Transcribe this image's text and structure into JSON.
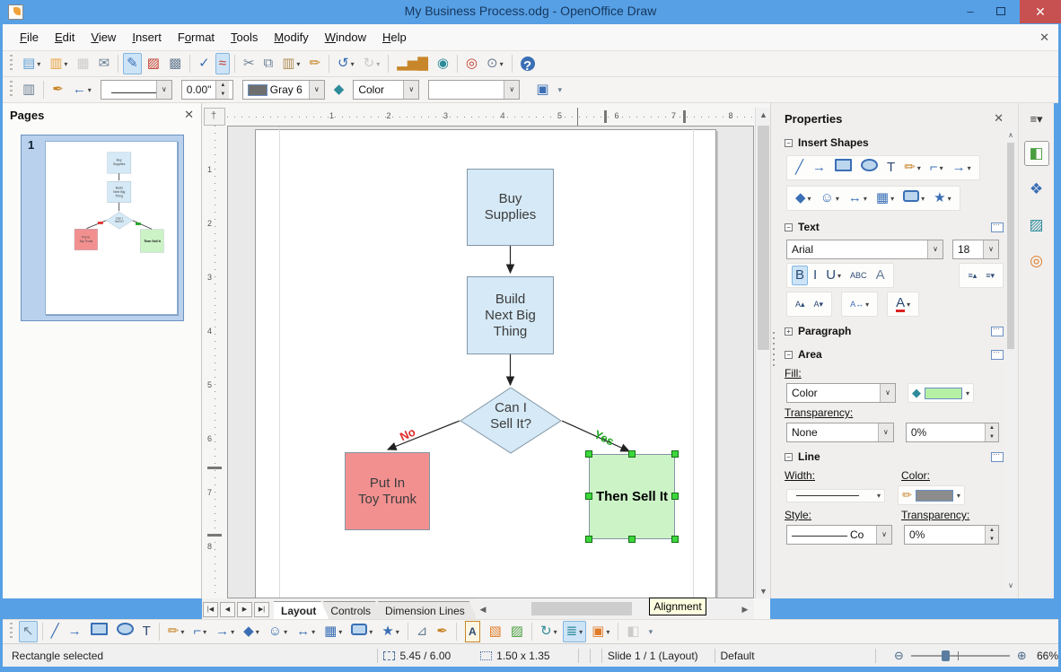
{
  "window": {
    "title": "My Business Process.odg - OpenOffice Draw",
    "minimize": "–",
    "close": "✕"
  },
  "menubar": {
    "items": [
      {
        "label": "File",
        "u": 0
      },
      {
        "label": "Edit",
        "u": 0
      },
      {
        "label": "View",
        "u": 0
      },
      {
        "label": "Insert",
        "u": 0
      },
      {
        "label": "Format",
        "u": 1
      },
      {
        "label": "Tools",
        "u": 0
      },
      {
        "label": "Modify",
        "u": 0
      },
      {
        "label": "Window",
        "u": 0
      },
      {
        "label": "Help",
        "u": 0
      }
    ],
    "close": "✕"
  },
  "toolbars": {
    "standard": [
      {
        "n": "new-document-icon",
        "g": "▤",
        "c": "ic-sky",
        "d": 1
      },
      {
        "n": "open-icon",
        "g": "▥",
        "c": "ic-amber",
        "d": 1
      },
      {
        "n": "save-icon",
        "g": "▦",
        "c": "ic-dis",
        "st": "dis"
      },
      {
        "n": "email-icon",
        "g": "✉",
        "c": "ic-slate"
      },
      {
        "t": "s"
      },
      {
        "n": "edit-file-icon",
        "g": "✎",
        "c": "ic-blue",
        "st": "on"
      },
      {
        "n": "export-pdf-icon",
        "g": "▨",
        "c": "ic-red"
      },
      {
        "n": "print-icon",
        "g": "▩",
        "c": "ic-slate"
      },
      {
        "t": "s"
      },
      {
        "n": "spelling-icon",
        "g": "✓",
        "c": "ic-blue"
      },
      {
        "n": "autospellcheck-icon",
        "g": "≈",
        "c": "ic-red",
        "st": "on"
      },
      {
        "t": "s"
      },
      {
        "n": "cut-icon",
        "g": "✂",
        "c": "ic-slate"
      },
      {
        "n": "copy-icon",
        "g": "⧉",
        "c": "ic-slate"
      },
      {
        "n": "paste-icon",
        "g": "▥",
        "c": "ic-tan",
        "d": 1
      },
      {
        "n": "clone-formatting-icon",
        "g": "✏",
        "c": "ic-gold"
      },
      {
        "t": "s"
      },
      {
        "n": "undo-icon",
        "g": "↺",
        "c": "ic-blue",
        "d": 1
      },
      {
        "n": "redo-icon",
        "g": "↻",
        "c": "ic-dis",
        "st": "dis",
        "d": 1
      },
      {
        "t": "s"
      },
      {
        "n": "chart-icon",
        "g": "▂▅▇",
        "c": "ic-gold"
      },
      {
        "n": "hyperlink-icon",
        "g": "◉",
        "c": "ic-teal"
      },
      {
        "t": "s"
      },
      {
        "n": "navigator-icon",
        "g": "◎",
        "c": "ic-red"
      },
      {
        "n": "zoom-icon",
        "g": "⊙",
        "c": "ic-slate",
        "d": 1
      },
      {
        "t": "s"
      },
      {
        "n": "help-icon",
        "g": "?",
        "c": "ic-help"
      }
    ],
    "linefill": {
      "pre": [
        {
          "n": "styles-window-icon",
          "g": "▥",
          "c": "ic-slate"
        },
        {
          "t": "s"
        },
        {
          "n": "line-dialog-icon",
          "g": "✒",
          "c": "ic-gold"
        },
        {
          "n": "arrowheads-icon",
          "g": "←",
          "c": "ic-blue",
          "d": 1
        }
      ],
      "line_width": "0.00\"",
      "line_color": "Gray 6",
      "fill_type": "Color",
      "post": [
        {
          "n": "shadow-icon",
          "g": "▣",
          "c": "ic-blue"
        },
        {
          "n": "toolbar-overflow-icon",
          "g": "▾",
          "c": "ic-slate",
          "cls": "small"
        }
      ]
    },
    "drawing": [
      {
        "n": "select-icon",
        "g": "↖",
        "c": "ic-slate",
        "st": "on"
      },
      {
        "t": "s"
      },
      {
        "n": "line-icon",
        "g": "╱",
        "c": "ic-blue"
      },
      {
        "n": "line-arrow-end-icon",
        "g": "→",
        "c": "ic-blue"
      },
      {
        "n": "rectangle-icon",
        "cls": "i-rect"
      },
      {
        "n": "ellipse-icon",
        "cls": "i-ellipse"
      },
      {
        "n": "text-icon",
        "g": "T",
        "c": "ic-navy"
      },
      {
        "t": "s"
      },
      {
        "n": "curve-icon",
        "g": "✏",
        "c": "ic-gold",
        "d": 1
      },
      {
        "n": "connector-icon",
        "g": "⌐",
        "c": "ic-blue",
        "d": 1
      },
      {
        "n": "lines-arrows-icon",
        "g": "→",
        "c": "ic-blue",
        "d": 1
      },
      {
        "n": "basic-shapes-icon",
        "g": "◆",
        "c": "ic-blue",
        "d": 1
      },
      {
        "n": "symbol-shapes-icon",
        "g": "☺",
        "c": "ic-blue",
        "d": 1
      },
      {
        "n": "block-arrows-icon",
        "g": "↔",
        "c": "ic-blue",
        "d": 1
      },
      {
        "n": "flowchart-icon",
        "g": "▦",
        "c": "ic-blue",
        "d": 1
      },
      {
        "n": "callouts-icon",
        "cls": "i-callout",
        "d": 1
      },
      {
        "n": "stars-icon",
        "g": "★",
        "c": "ic-blue",
        "d": 1
      },
      {
        "t": "s"
      },
      {
        "n": "edit-points-icon",
        "g": "⊿",
        "c": "ic-slate"
      },
      {
        "n": "glue-points-icon",
        "g": "✒",
        "c": "ic-gold"
      },
      {
        "t": "s"
      },
      {
        "n": "fontwork-icon",
        "g": "A",
        "cls": "i-fontwork"
      },
      {
        "n": "from-file-icon",
        "g": "▧",
        "c": "ic-orange"
      },
      {
        "n": "gallery-icon",
        "g": "▨",
        "c": "ic-green"
      },
      {
        "t": "s"
      },
      {
        "n": "rotate-icon",
        "g": "↻",
        "c": "ic-teal",
        "d": 1
      },
      {
        "n": "alignment-icon",
        "g": "≣",
        "c": "ic-teal",
        "st": "on",
        "d": 1
      },
      {
        "n": "arrange-icon",
        "g": "▣",
        "c": "ic-orange",
        "d": 1
      },
      {
        "t": "s"
      },
      {
        "n": "effects-3d-icon",
        "g": "◧",
        "c": "ic-dis",
        "st": "dis"
      },
      {
        "n": "toolbar-overflow-icon",
        "g": "▾",
        "c": "ic-slate",
        "cls": "small"
      }
    ]
  },
  "pages": {
    "title": "Pages",
    "close": "✕",
    "page_number": "1"
  },
  "canvas": {
    "h_ruler": [
      "1",
      "2",
      "3",
      "4",
      "5",
      "6",
      "7",
      "8"
    ],
    "v_ruler": [
      "1",
      "2",
      "3",
      "4",
      "5",
      "6",
      "7",
      "8"
    ],
    "tabs": [
      "Layout",
      "Controls",
      "Dimension Lines"
    ],
    "active_tab": "Layout",
    "tooltip": "Alignment"
  },
  "flowchart": {
    "buy": {
      "l1": "Buy",
      "l2": "Supplies"
    },
    "build": {
      "l1": "Build",
      "l2": "Next Big",
      "l3": "Thing"
    },
    "decision": {
      "l1": "Can I",
      "l2": "Sell It?"
    },
    "reject": {
      "l1": "Put In",
      "l2": "Toy Trunk"
    },
    "accept": {
      "l1": "Then Sell It"
    },
    "no_label": "No",
    "yes_label": "Yes",
    "colors": {
      "process_fill": "#d5e9f6",
      "reject_fill": "#f29090",
      "accept_fill": "#ccf3c6",
      "selection_handle": "#3cd73c",
      "no_label": "#e02a2a",
      "yes_label": "#1ea31e"
    }
  },
  "properties": {
    "title": "Properties",
    "close": "✕",
    "insert_shapes": {
      "title": "Insert Shapes",
      "row1": [
        {
          "n": "insert-line-icon",
          "g": "╱",
          "c": "ic-blue"
        },
        {
          "n": "insert-arrow-icon",
          "g": "→",
          "c": "ic-blue"
        },
        {
          "n": "insert-rectangle-icon",
          "cls": "i-rect"
        },
        {
          "n": "insert-ellipse-icon",
          "cls": "i-ellipse"
        },
        {
          "n": "insert-text-icon",
          "g": "T",
          "c": "ic-navy"
        },
        {
          "n": "insert-curve-icon",
          "g": "✏",
          "c": "ic-gold",
          "d": 1
        },
        {
          "n": "insert-connector-icon",
          "g": "⌐",
          "c": "ic-blue",
          "d": 1
        },
        {
          "n": "insert-lines-arrows-icon",
          "g": "→",
          "c": "ic-blue",
          "d": 1
        }
      ],
      "row2": [
        {
          "n": "basic-shapes-icon",
          "g": "◆",
          "c": "ic-blue",
          "d": 1
        },
        {
          "n": "symbol-shapes-icon",
          "g": "☺",
          "c": "ic-blue",
          "d": 1
        },
        {
          "n": "block-arrows-icon",
          "g": "↔",
          "c": "ic-blue",
          "d": 1
        },
        {
          "n": "flowchart-shapes-icon",
          "g": "▦",
          "c": "ic-blue",
          "d": 1
        },
        {
          "n": "callout-shapes-icon",
          "cls": "i-callout",
          "d": 1
        },
        {
          "n": "star-shapes-icon",
          "g": "★",
          "c": "ic-blue",
          "d": 1
        }
      ]
    },
    "text": {
      "title": "Text",
      "font_name": "Arial",
      "font_size": "18",
      "row1": [
        {
          "n": "bold-icon",
          "g": "B",
          "c": "ic-navy",
          "st": "on"
        },
        {
          "n": "italic-icon",
          "g": "I",
          "c": "ic-navy"
        },
        {
          "n": "underline-icon",
          "g": "U",
          "c": "ic-navy",
          "d": 1
        },
        {
          "n": "strikethrough-icon",
          "g": "ABC",
          "c": "ic-navy",
          "cls": "small"
        },
        {
          "n": "shadow-text-icon",
          "g": "A",
          "c": "ic-slate"
        }
      ],
      "row1b": [
        {
          "n": "increase-spacing-icon",
          "g": "≡▴",
          "c": "ic-navy",
          "cls": "small"
        },
        {
          "n": "decrease-spacing-icon",
          "g": "≡▾",
          "c": "ic-navy",
          "cls": "small"
        }
      ],
      "row2a": [
        {
          "n": "increase-font-icon",
          "g": "A▴",
          "c": "ic-navy",
          "cls": "small"
        },
        {
          "n": "decrease-font-icon",
          "g": "A▾",
          "c": "ic-navy",
          "cls": "small"
        }
      ],
      "row2b": [
        {
          "n": "character-spacing-icon",
          "g": "A↔",
          "c": "ic-blue",
          "cls": "small",
          "d": 1
        }
      ],
      "row2c": [
        {
          "n": "font-color-icon",
          "g": "A",
          "c": "ic-navy",
          "cls": "i-fontcolor",
          "d": 1
        }
      ]
    },
    "paragraph": {
      "title": "Paragraph"
    },
    "area": {
      "title": "Area",
      "fill_label": "Fill:",
      "fill_type": "Color",
      "fill_color": "#b5f0a5",
      "transparency_label": "Transparency:",
      "transparency_type": "None",
      "transparency_value": "0%"
    },
    "line": {
      "title": "Line",
      "width_label": "Width:",
      "color_label": "Color:",
      "line_color": "#8c8c8c",
      "style_label": "Style:",
      "style_value": "Co",
      "transparency_label": "Transparency:",
      "transparency_value": "0%"
    }
  },
  "sidebar_tabs": [
    {
      "n": "properties-tab-icon",
      "g": "◧",
      "c": "ic-green",
      "sel": 1
    },
    {
      "n": "gallery-tab-icon",
      "g": "❖",
      "c": "ic-blue"
    },
    {
      "n": "images-tab-icon",
      "g": "▨",
      "c": "ic-teal"
    },
    {
      "n": "navigator-tab-icon",
      "g": "◎",
      "c": "ic-orange"
    }
  ],
  "statusbar": {
    "selection": "Rectangle selected",
    "position": "5.45 / 6.00",
    "size": "1.50 x 1.35",
    "slide": "Slide 1 / 1 (Layout)",
    "style": "Default",
    "zoom_out": "⊖",
    "zoom_in": "⊕",
    "zoom": "66%"
  }
}
